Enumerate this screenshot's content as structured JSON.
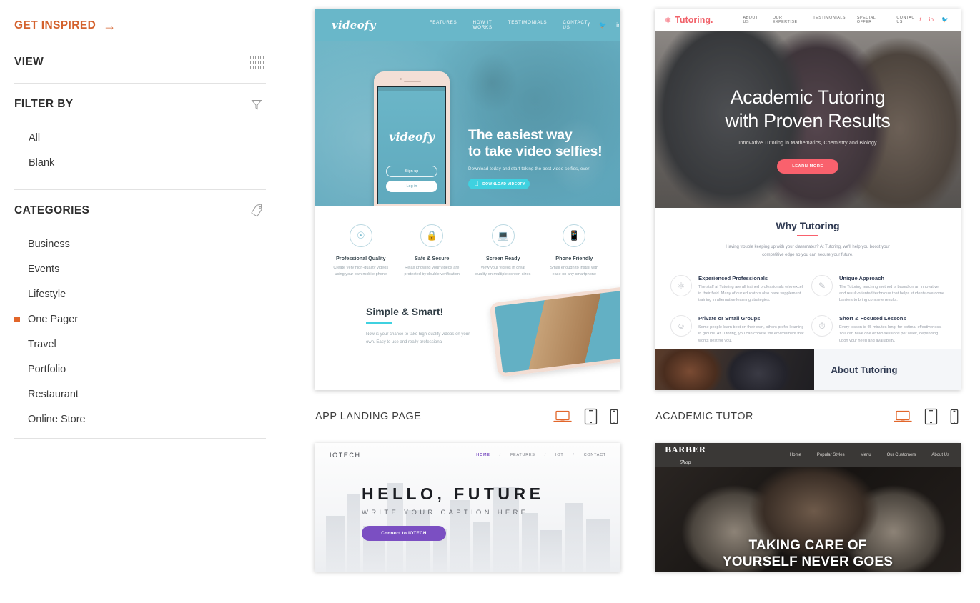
{
  "sidebar": {
    "get_inspired": {
      "label": "GET INSPIRED",
      "icon": "arrow-right-icon",
      "color": "#d4612c"
    },
    "view": {
      "title": "VIEW",
      "icon": "grid-icon"
    },
    "filter_by": {
      "title": "FILTER BY",
      "icon": "funnel-icon",
      "options": [
        {
          "label": "All",
          "active": false
        },
        {
          "label": "Blank",
          "active": false
        }
      ]
    },
    "categories": {
      "title": "CATEGORIES",
      "icon": "tag-icon",
      "options": [
        {
          "label": "Business",
          "active": false
        },
        {
          "label": "Events",
          "active": false
        },
        {
          "label": "Lifestyle",
          "active": false
        },
        {
          "label": "One Pager",
          "active": true
        },
        {
          "label": "Travel",
          "active": false
        },
        {
          "label": "Portfolio",
          "active": false
        },
        {
          "label": "Restaurant",
          "active": false
        },
        {
          "label": "Online Store",
          "active": false
        }
      ]
    }
  },
  "templates": [
    {
      "caption": "APP LANDING PAGE",
      "devices": [
        {
          "name": "desktop-icon",
          "active": true
        },
        {
          "name": "tablet-icon",
          "active": false
        },
        {
          "name": "mobile-icon",
          "active": false
        }
      ],
      "preview": {
        "logo": "videofy",
        "nav": [
          "FEATURES",
          "HOW IT WORKS",
          "TESTIMONIALS",
          "CONTACT US"
        ],
        "social": [
          "f",
          "t",
          "in"
        ],
        "headline": "The easiest way\nto take video selfies!",
        "subhead": "Download today and start taking the best video selfies, ever!",
        "cta": "DOWNLOAD VIDEOFY",
        "phone": {
          "logo": "videofy",
          "signup": "Sign up",
          "login": "Log in"
        },
        "features": [
          {
            "icon": "camera-icon",
            "title": "Professional Quality",
            "desc": "Create very high-quality videos using your own mobile phone"
          },
          {
            "icon": "lock-icon",
            "title": "Safe & Secure",
            "desc": "Relax knowing your videos are protected by double verification"
          },
          {
            "icon": "monitor-icon",
            "title": "Screen Ready",
            "desc": "View your videos in great quality on multiple screen sizes"
          },
          {
            "icon": "phone-icon",
            "title": "Phone Friendly",
            "desc": "Small enough to install with ease on any smartphone"
          }
        ],
        "simple_title": "Simple & Smart!",
        "simple_desc": "Now is your chance to take high-quality videos on your own. Easy to use and really professional"
      }
    },
    {
      "caption": "ACADEMIC TUTOR",
      "devices": [
        {
          "name": "desktop-icon",
          "active": true
        },
        {
          "name": "tablet-icon",
          "active": false
        },
        {
          "name": "mobile-icon",
          "active": false
        }
      ],
      "preview": {
        "logo": "Tutoring.",
        "nav": [
          "ABOUT US",
          "OUR EXPERTISE",
          "TESTIMONIALS",
          "SPECIAL OFFER",
          "CONTACT US"
        ],
        "social": [
          "f",
          "in",
          "t"
        ],
        "headline": "Academic Tutoring\nwith Proven Results",
        "subhead": "Innovative Tutoring in Mathematics, Chemistry and Biology",
        "cta": "LEARN MORE",
        "why_title": "Why Tutoring",
        "why_lead": "Having trouble keeping up with your classmates? At Tutoring, we'll help you boost your competitive edge so you can secure your future.",
        "features": [
          {
            "icon": "atom-icon",
            "title": "Experienced Professionals",
            "desc": "The staff at Tutoring are all trained professionals who excel in their field. Many of our educators also have supplement training in alternative learning strategies."
          },
          {
            "icon": "pen-icon",
            "title": "Unique Approach",
            "desc": "The Tutoring teaching method is based on an innovative and result-oriented technique that helps students overcome barriers to bring concrete results."
          },
          {
            "icon": "user-icon",
            "title": "Private or Small Groups",
            "desc": "Some people learn best on their own, others prefer learning in groups. At Tutoring, you can choose the environment that works best for you."
          },
          {
            "icon": "clock-icon",
            "title": "Short & Focused Lessons",
            "desc": "Every lesson is 45 minutes long, for optimal effectiveness. You can have one or two sessions per week, depending upon your need and availability."
          }
        ],
        "about_title": "About Tutoring"
      }
    },
    {
      "caption": "",
      "devices": [],
      "preview": {
        "logo": "IOTECH",
        "nav": [
          "HOME",
          "FEATURES",
          "IOT",
          "CONTACT"
        ],
        "nav_separator": "/",
        "headline": "HELLO, FUTURE",
        "subhead": "WRITE YOUR CAPTION HERE",
        "cta": "Connect to IOTECH",
        "accent": "#7b4fc2"
      }
    },
    {
      "caption": "",
      "devices": [],
      "preview": {
        "logo_top": "BARBER",
        "logo_bottom": "Shop",
        "nav": [
          "Home",
          "Popular Styles",
          "Menu",
          "Our Customers",
          "About Us"
        ],
        "headline": "TAKING CARE OF\nYOURSELF NEVER GOES"
      }
    }
  ]
}
